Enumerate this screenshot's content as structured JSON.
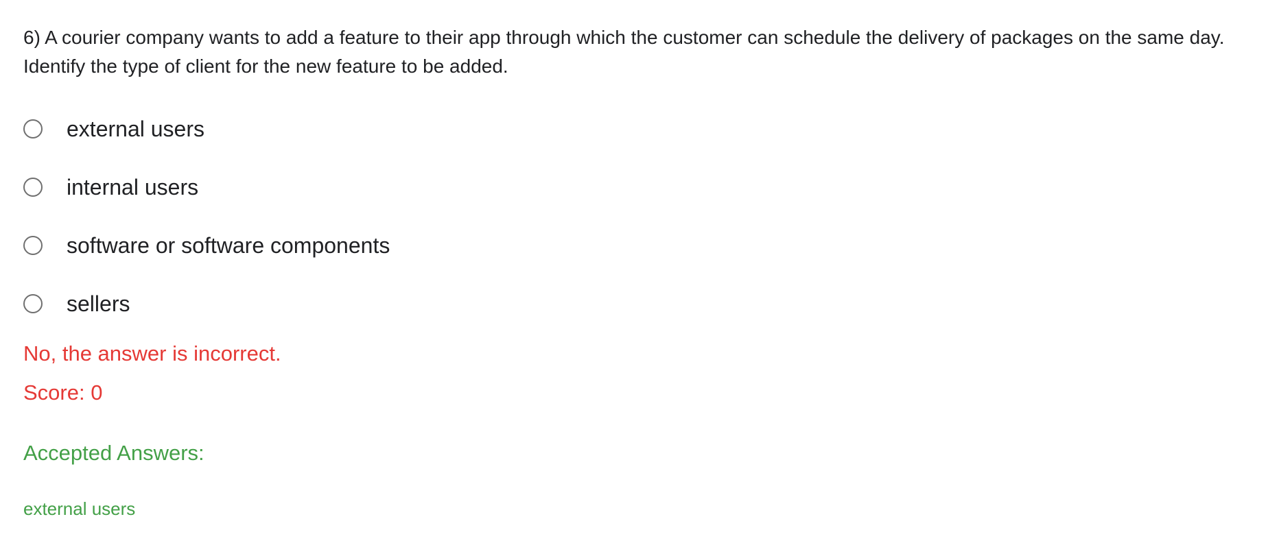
{
  "question": {
    "text": "6) A courier company wants to add a feature to their app through which the customer can schedule the delivery of packages on the same day. Identify the type of client for the new feature to be added."
  },
  "options": [
    {
      "label": "external users",
      "selected": false
    },
    {
      "label": "internal users",
      "selected": false
    },
    {
      "label": "software or software components",
      "selected": false
    },
    {
      "label": "sellers",
      "selected": false
    }
  ],
  "feedback": {
    "result_text": "No, the answer is incorrect.",
    "score_text": "Score: 0",
    "result_color": "#e53935"
  },
  "accepted": {
    "title": "Accepted Answers:",
    "answers": [
      "external users"
    ],
    "color": "#43a047"
  }
}
